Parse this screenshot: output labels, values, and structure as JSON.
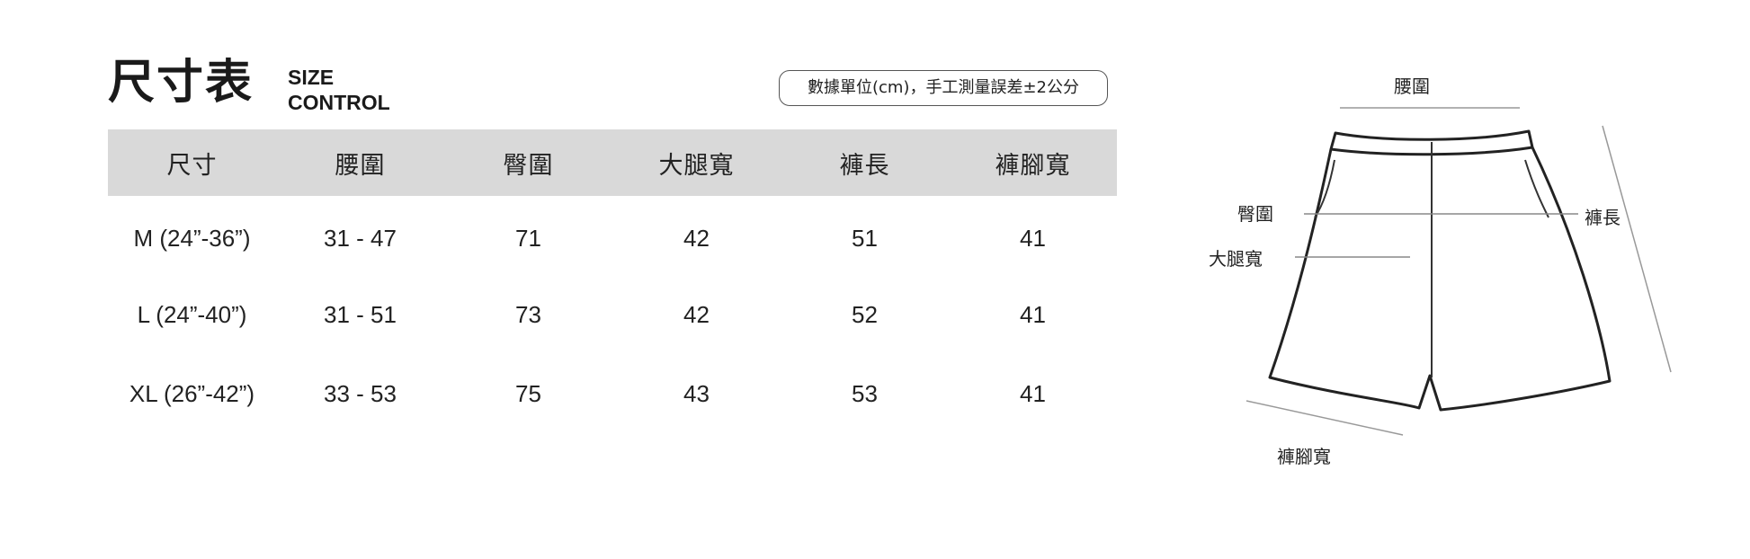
{
  "header": {
    "title": "尺寸表",
    "subtitle_line1": "SIZE",
    "subtitle_line2": "CONTROL",
    "note": "數據單位(cm)，手工測量誤差±2公分"
  },
  "table": {
    "columns": [
      "尺寸",
      "腰圍",
      "臀圍",
      "大腿寬",
      "褲長",
      "褲腳寬"
    ],
    "rows": [
      [
        "M (24”-36”)",
        "31 - 47",
        "71",
        "42",
        "51",
        "41"
      ],
      [
        "L (24”-40”)",
        "31 - 51",
        "73",
        "42",
        "52",
        "41"
      ],
      [
        "XL (26”-42”)",
        "33 - 53",
        "75",
        "43",
        "53",
        "41"
      ]
    ]
  },
  "diagram": {
    "labels": {
      "waist": "腰圍",
      "hip": "臀圍",
      "thigh": "大腿寬",
      "length": "褲長",
      "hem": "褲腳寬"
    }
  }
}
